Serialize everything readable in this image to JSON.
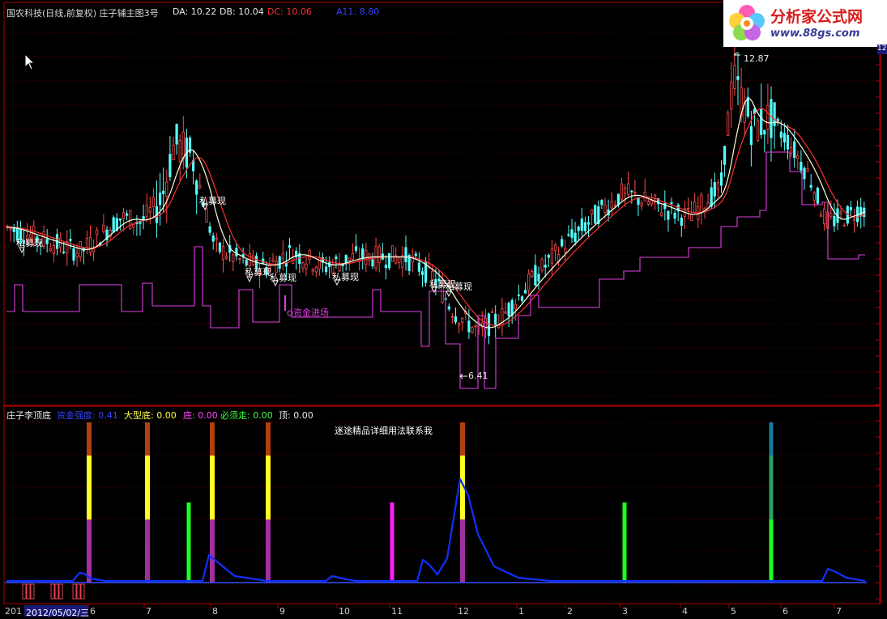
{
  "main_header": {
    "title": "国农科技(日线,前复权) 庄子辅主图3号",
    "da": "DA: 10.22",
    "db": "DB: 10.04",
    "dc": "DC: 10.06",
    "a11": "A11: 8.80"
  },
  "logo": {
    "name": "分析家公式网",
    "url": "www.88gs.com"
  },
  "right_axis_tag": "12",
  "main_annotations": {
    "signal_label": "私募现",
    "capital_in": "资金进场",
    "high_price": "12.87",
    "low_price": "6.41"
  },
  "sub_header": {
    "title": "庄子李顶底",
    "strength": "资金强度: 0.41",
    "big_bottom": "大型底: 0.00",
    "bottom": "底: 0.00",
    "must_go": "必须走: 0.00",
    "top": "顶: 0.00",
    "note": "迷途精品详细用法联系我"
  },
  "date_axis": {
    "first": "201",
    "current": "2012/05/02/三",
    "months": [
      "6",
      "7",
      "8",
      "9",
      "10",
      "11",
      "12",
      "1",
      "2",
      "3",
      "4",
      "5",
      "6",
      "7"
    ]
  },
  "colors": {
    "up": "#ff4a4a",
    "down": "#54ffff",
    "ma_fast": "#ffffe0",
    "ma_slow": "#ff3030",
    "support": "#e040e0",
    "strength": "#1030ff",
    "purple_bar": "#a030a0",
    "yellow_bar": "#ffff20",
    "green_bar": "#20ff20",
    "magenta_bar": "#ff20ff",
    "border": "#b00000",
    "grid": "#800000"
  },
  "chart_data": [
    {
      "type": "candlestick",
      "title": "国农科技(日线,前复权) 庄子辅主图3号",
      "x": [
        "2011-05",
        "2011-06",
        "2011-07",
        "2011-08",
        "2011-09",
        "2011-10",
        "2011-11",
        "2011-12",
        "2012-01",
        "2012-02",
        "2012-03",
        "2012-04",
        "2012-05",
        "2012-06",
        "2012-07"
      ],
      "series": [
        {
          "name": "DA",
          "values": [
            9.3,
            9.0,
            9.9,
            10.2,
            8.9,
            8.7,
            8.9,
            8.6,
            8.1,
            9.0,
            9.8,
            10.0,
            11.9,
            10.5,
            10.2
          ]
        },
        {
          "name": "DB",
          "values": [
            9.2,
            9.0,
            9.6,
            10.3,
            9.0,
            8.8,
            8.8,
            8.6,
            8.2,
            8.8,
            9.6,
            9.9,
            11.8,
            10.6,
            10.0
          ]
        },
        {
          "name": "DC",
          "values": [
            7.8,
            7.8,
            8.3,
            8.5,
            7.9,
            7.9,
            7.9,
            7.3,
            6.5,
            8.0,
            8.4,
            9.2,
            10.5,
            8.6,
            8.4
          ]
        }
      ],
      "annotations": {
        "high": 12.87,
        "low": 6.41
      }
    },
    {
      "type": "bar",
      "title": "庄子李顶底",
      "series": [
        {
          "name": "资金强度",
          "latest": 0.41
        },
        {
          "name": "大型底",
          "latest": 0.0
        },
        {
          "name": "底",
          "latest": 0.0
        },
        {
          "name": "必须走",
          "latest": 0.0
        },
        {
          "name": "顶",
          "latest": 0.0
        }
      ]
    }
  ]
}
